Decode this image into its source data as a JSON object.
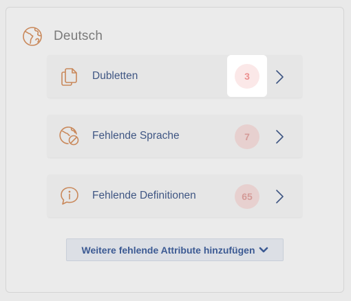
{
  "language_panel": {
    "title": "Deutsch",
    "icon": "globe-icon"
  },
  "items": [
    {
      "label": "Dubletten",
      "count": "3",
      "icon": "duplicate-copy-icon"
    },
    {
      "label": "Fehlende Sprache",
      "count": "7",
      "icon": "globe-missing-icon"
    },
    {
      "label": "Fehlende Definitionen",
      "count": "65",
      "icon": "info-speech-bubble-icon"
    }
  ],
  "more_button": {
    "label": "Weitere fehlende Attribute hinzufügen",
    "icon": "chevron-down-icon"
  },
  "colors": {
    "accent_orange": "#c9885a",
    "link_blue": "#3f5683",
    "badge_bg": "#e7d0cf",
    "badge_text": "#d49b98"
  }
}
